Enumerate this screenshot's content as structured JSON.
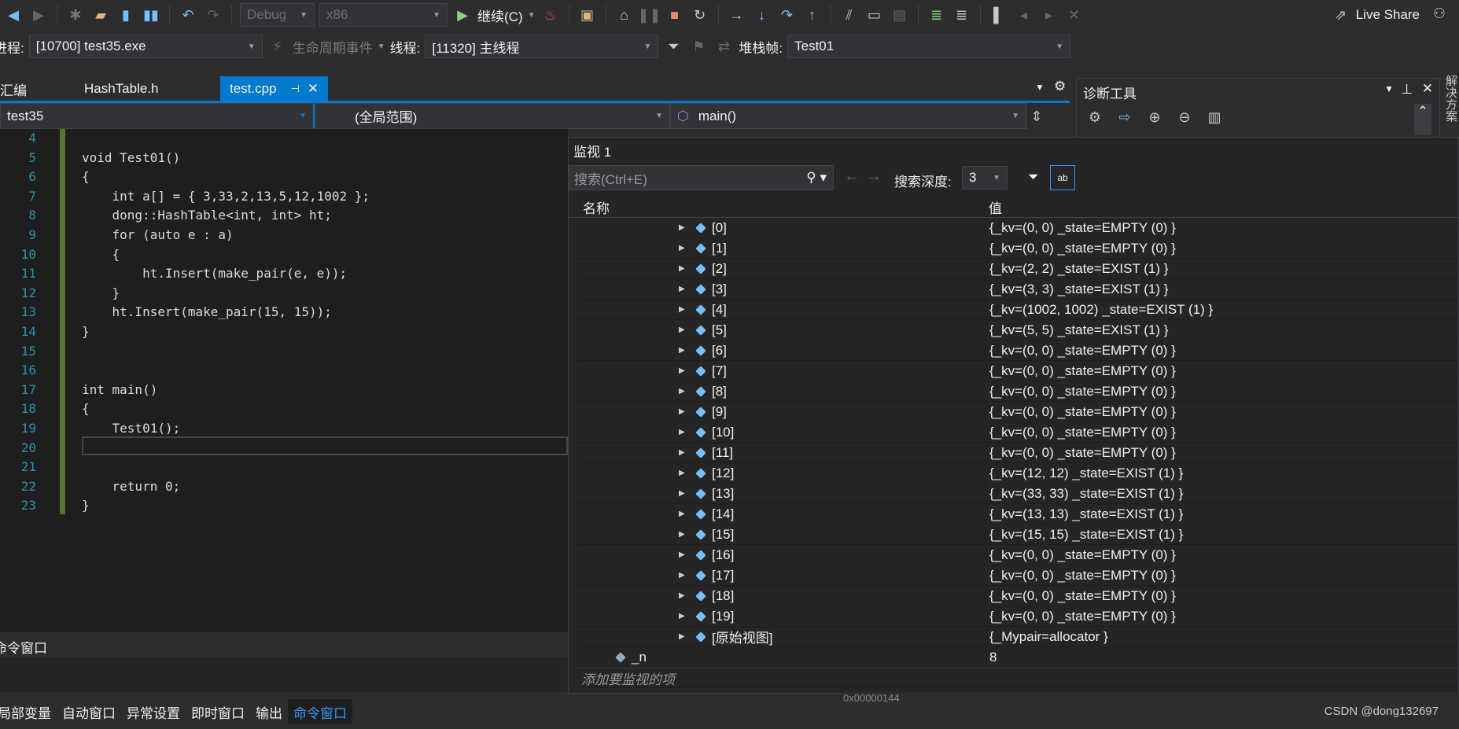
{
  "toolbar": {
    "config": "Debug",
    "platform": "x86",
    "continue": "继续(C)",
    "live_share": "Live Share"
  },
  "debug_bar": {
    "process_label": "进程:",
    "process": "[10700] test35.exe",
    "lifecycle": "生命周期事件",
    "thread_label": "线程:",
    "thread": "[11320] 主线程",
    "stack_label": "堆栈帧:",
    "stack": "Test01"
  },
  "tabs": [
    {
      "label": "汇编"
    },
    {
      "label": "HashTable.h"
    },
    {
      "label": "test.cpp",
      "active": true
    }
  ],
  "nav": {
    "project": "test35",
    "scope": "(全局范围)",
    "member": "main()"
  },
  "diag": {
    "title": "诊断工具"
  },
  "side_tab": "解决方案",
  "code": {
    "lines": [
      {
        "n": "4",
        "t": ""
      },
      {
        "n": "5",
        "t": "void Test01()"
      },
      {
        "n": "6",
        "t": "{"
      },
      {
        "n": "7",
        "t": "    int a[] = { 3,33,2,13,5,12,1002 };"
      },
      {
        "n": "8",
        "t": "    dong::HashTable<int, int> ht;"
      },
      {
        "n": "9",
        "t": "    for (auto e : a)"
      },
      {
        "n": "10",
        "t": "    {"
      },
      {
        "n": "11",
        "t": "        ht.Insert(make_pair(e, e));"
      },
      {
        "n": "12",
        "t": "    }"
      },
      {
        "n": "13",
        "t": "    ht.Insert(make_pair(15, 15));"
      },
      {
        "n": "14",
        "t": "}"
      },
      {
        "n": "15",
        "t": ""
      },
      {
        "n": "16",
        "t": ""
      },
      {
        "n": "17",
        "t": "int main()"
      },
      {
        "n": "18",
        "t": "{"
      },
      {
        "n": "19",
        "t": "    Test01();"
      },
      {
        "n": "20",
        "t": ""
      },
      {
        "n": "21",
        "t": ""
      },
      {
        "n": "22",
        "t": "    return 0;"
      },
      {
        "n": "23",
        "t": "}"
      }
    ]
  },
  "watch": {
    "title": "监视 1",
    "search_placeholder": "搜索(Ctrl+E)",
    "depth_label": "搜索深度:",
    "depth": "3",
    "col_name": "名称",
    "col_value": "值",
    "rows": [
      {
        "name": "[0]",
        "value": "{_kv=(0, 0) _state=EMPTY (0) }"
      },
      {
        "name": "[1]",
        "value": "{_kv=(0, 0) _state=EMPTY (0) }"
      },
      {
        "name": "[2]",
        "value": "{_kv=(2, 2) _state=EXIST (1) }"
      },
      {
        "name": "[3]",
        "value": "{_kv=(3, 3) _state=EXIST (1) }"
      },
      {
        "name": "[4]",
        "value": "{_kv=(1002, 1002) _state=EXIST (1) }"
      },
      {
        "name": "[5]",
        "value": "{_kv=(5, 5) _state=EXIST (1) }"
      },
      {
        "name": "[6]",
        "value": "{_kv=(0, 0) _state=EMPTY (0) }"
      },
      {
        "name": "[7]",
        "value": "{_kv=(0, 0) _state=EMPTY (0) }"
      },
      {
        "name": "[8]",
        "value": "{_kv=(0, 0) _state=EMPTY (0) }"
      },
      {
        "name": "[9]",
        "value": "{_kv=(0, 0) _state=EMPTY (0) }"
      },
      {
        "name": "[10]",
        "value": "{_kv=(0, 0) _state=EMPTY (0) }"
      },
      {
        "name": "[11]",
        "value": "{_kv=(0, 0) _state=EMPTY (0) }"
      },
      {
        "name": "[12]",
        "value": "{_kv=(12, 12) _state=EXIST (1) }"
      },
      {
        "name": "[13]",
        "value": "{_kv=(33, 33) _state=EXIST (1) }"
      },
      {
        "name": "[14]",
        "value": "{_kv=(13, 13) _state=EXIST (1) }"
      },
      {
        "name": "[15]",
        "value": "{_kv=(15, 15) _state=EXIST (1) }"
      },
      {
        "name": "[16]",
        "value": "{_kv=(0, 0) _state=EMPTY (0) }"
      },
      {
        "name": "[17]",
        "value": "{_kv=(0, 0) _state=EMPTY (0) }"
      },
      {
        "name": "[18]",
        "value": "{_kv=(0, 0) _state=EMPTY (0) }"
      },
      {
        "name": "[19]",
        "value": "{_kv=(0, 0) _state=EMPTY (0) }"
      },
      {
        "name": "[原始视图]",
        "value": "{_Mypair=allocator }"
      }
    ],
    "n_row": {
      "name": "_n",
      "value": "8"
    },
    "add_placeholder": "添加要监视的项"
  },
  "memory": {
    "address": "0x00000144"
  },
  "command_panel": {
    "title": "命令窗口"
  },
  "bottom_tabs": [
    "局部变量",
    "自动窗口",
    "异常设置",
    "即时窗口",
    "输出",
    "命令窗口"
  ],
  "watermark": "CSDN @dong132697"
}
